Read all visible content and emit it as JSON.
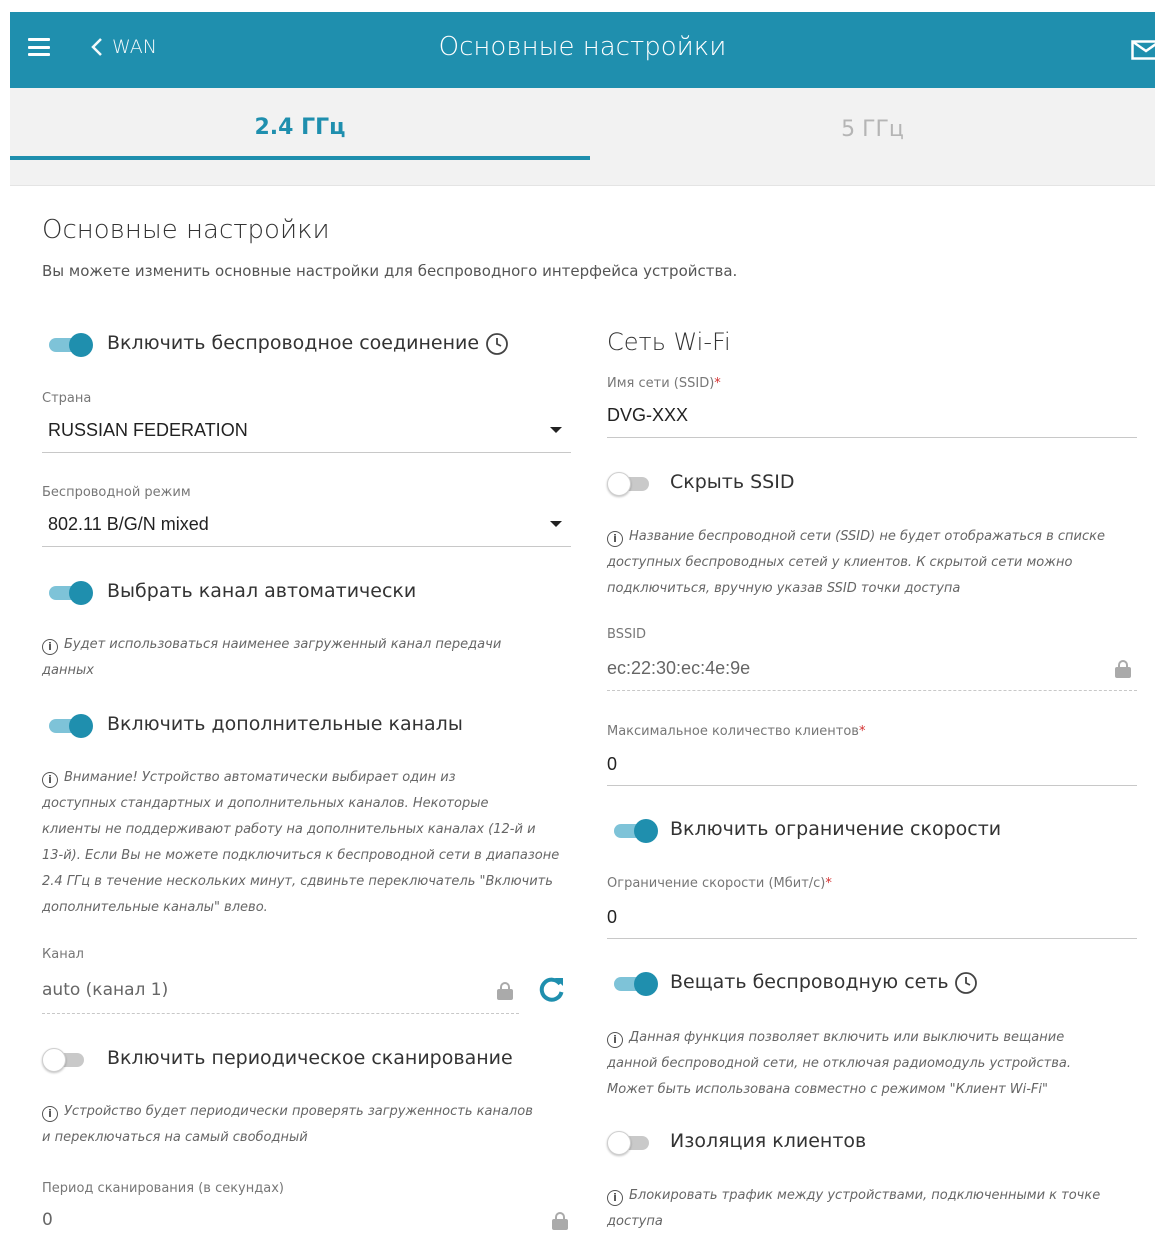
{
  "header": {
    "back_label": "WAN",
    "title": "Основные настройки"
  },
  "tabs": [
    {
      "label": "2.4 ГГц",
      "active": true
    },
    {
      "label": "5 ГГц",
      "active": false
    }
  ],
  "section": {
    "title": "Основные настройки",
    "description": "Вы можете изменить основные настройки для беспроводного интерфейса устройства."
  },
  "left": {
    "enable_wireless": {
      "label": "Включить беспроводное соединение",
      "on": true
    },
    "country": {
      "label": "Страна",
      "value": "RUSSIAN FEDERATION"
    },
    "mode": {
      "label": "Беспроводной режим",
      "value": "802.11 B/G/N mixed"
    },
    "auto_channel": {
      "label": "Выбрать канал автоматически",
      "on": true
    },
    "auto_channel_hint_1": "Будет использоваться наименее загруженный канал передачи",
    "auto_channel_hint_2": "данных",
    "extra_channels": {
      "label": "Включить дополнительные каналы",
      "on": true
    },
    "extra_hint": [
      "Внимание! Устройство автоматически выбирает один из",
      "доступных стандартных и дополнительных каналов. Некоторые",
      "клиенты не поддерживают работу на дополнительных каналах (12-й и",
      "13-й). Если Вы не можете подключиться к беспроводной сети в диапазоне",
      "2.4 ГГц в течение нескольких минут, сдвиньте переключатель \"Включить",
      "дополнительные каналы\" влево."
    ],
    "channel": {
      "label": "Канал",
      "value": "auto (канал 1)"
    },
    "periodic_scan": {
      "label": "Включить периодическое сканирование",
      "on": false
    },
    "scan_hint_1": "Устройство будет периодически проверять загруженность каналов",
    "scan_hint_2": "и переключаться на самый свободный",
    "scan_period": {
      "label": "Период сканирования (в секундах)",
      "value": "0"
    }
  },
  "right": {
    "title": "Сеть Wi-Fi",
    "ssid": {
      "label": "Имя сети (SSID)",
      "required_mark": "*",
      "value": "DVG-XXX"
    },
    "hide_ssid": {
      "label": "Скрыть SSID",
      "on": false
    },
    "hide_hint": [
      "Название беспроводной сети (SSID) не будет отображаться в списке",
      "доступных беспроводных сетей у клиентов. К скрытой сети можно",
      "подключиться, вручную указав SSID точки доступа"
    ],
    "bssid": {
      "label": "BSSID",
      "value": "ec:22:30:ec:4e:9e"
    },
    "max_clients": {
      "label": "Максимальное количество клиентов",
      "required_mark": "*",
      "value": "0"
    },
    "speed_limit_toggle": {
      "label": "Включить ограничение скорости",
      "on": true
    },
    "speed_limit": {
      "label": "Ограничение скорости (Мбит/с)",
      "required_mark": "*",
      "value": "0"
    },
    "broadcast": {
      "label": "Вещать беспроводную сеть",
      "on": true
    },
    "broadcast_hint": [
      "Данная функция позволяет включить или выключить вещание",
      "данной беспроводной сети, не отключая радиомодуль устройства.",
      "Может быть использована совместно с режимом \"Клиент Wi-Fi\""
    ],
    "isolation": {
      "label": "Изоляция клиентов",
      "on": false
    },
    "isolation_hint": [
      "Блокировать трафик между устройствами, подключенными к точке",
      "доступа"
    ]
  },
  "colors": {
    "accent": "#1f8fae",
    "toggle_track_on": "#7ec3d8",
    "tab_bg": "#f2f2f2"
  }
}
